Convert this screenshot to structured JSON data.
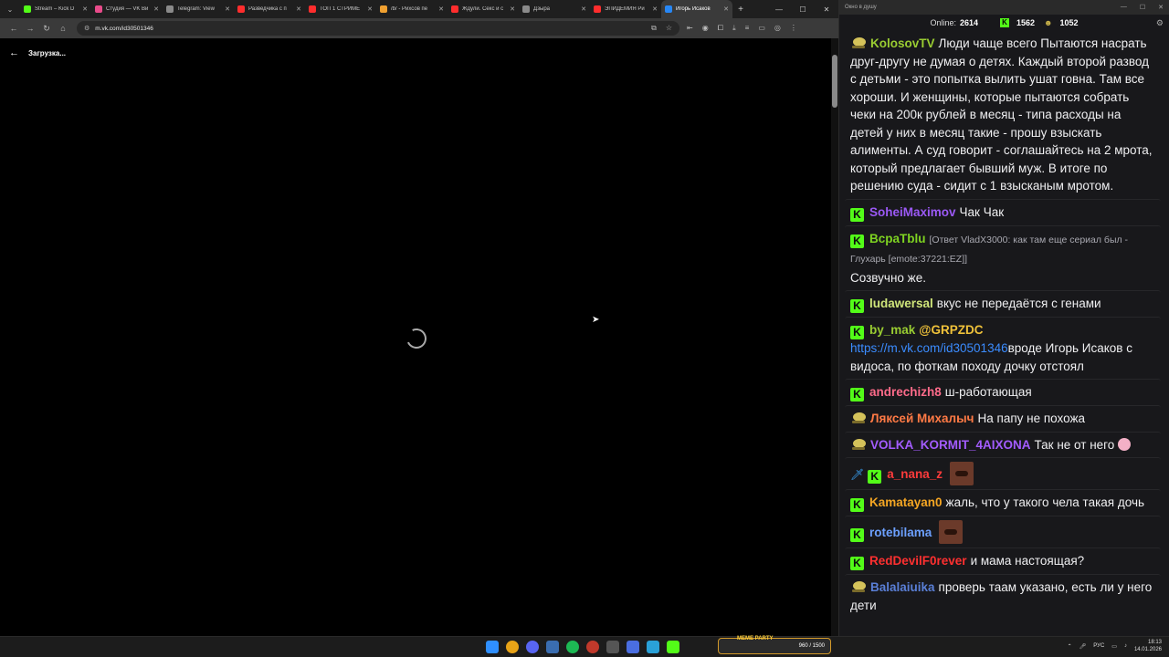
{
  "browser": {
    "tabs": [
      {
        "title": "Stream – Kick D",
        "color": "#53fc18"
      },
      {
        "title": "Студия — VK Ви",
        "color": "#e94b8a"
      },
      {
        "title": "Telegram: View",
        "color": "#8a8a8a"
      },
      {
        "title": "Разведчика с п",
        "color": "#ff2d2d"
      },
      {
        "title": "ТОП 1 СТРИМЕ",
        "color": "#ff2d2d"
      },
      {
        "title": "/b/ - Рихсов пе",
        "color": "#f0a030"
      },
      {
        "title": "Ждули. Секс и с",
        "color": "#ff2d2d"
      },
      {
        "title": "Дзыра",
        "color": "#8a8a8a"
      },
      {
        "title": "ЭПИДЕМИЯ Ри",
        "color": "#ff2d2d"
      },
      {
        "title": "Игорь Исаков",
        "color": "#2787f5",
        "active": true
      }
    ],
    "url": "m.vk.com/id30501346",
    "page_header": "Загрузка..."
  },
  "chat": {
    "window_title": "Окно в душу",
    "online_label": "Online:",
    "online_count": "2614",
    "kick_count": "1562",
    "other_count": "1052",
    "messages": [
      {
        "user": "KolosovTV",
        "color": "#9acd32",
        "badge": "gold",
        "text": "Люди чаще всего Пытаются насрать друг-другу не думая о детях. Каждый второй развод с детьми - это попытка вылить ушат говна. Там все хороши. И женщины, которые пытаются собрать чеки на 200к рублей в месяц - типа расходы на детей у них в месяц такие - прошу взыскать алименты. А суд говорит - соглашайтесь на 2 мрота, который предлагает бывший муж. В итоге по решению суда - сидит с 1 взысканым мротом."
      },
      {
        "user": "SoheiMaximov",
        "color": "#9b59f5",
        "badge": "kick",
        "text": "Чак Чак"
      },
      {
        "user": "ВсраТblu",
        "color": "#7ed321",
        "badge": "kick",
        "reply": "[Ответ VladX3000: как там еще сериал был - Глухарь [emote:37221:EZ]]",
        "text": "Созвучно же."
      },
      {
        "user": "ludawersal",
        "color": "#cfe57a",
        "badge": "kick",
        "text": "вкус не передаётся с генами"
      },
      {
        "user": "by_mak",
        "color": "#9acd32",
        "badge": "kick",
        "mention": "@GRPZDC",
        "link": "https://m.vk.com/id30501346",
        "text": "вроде Игорь Исаков с видоса, по фоткам походу дочку отстоял"
      },
      {
        "user": "andrechizh8",
        "color": "#ff6b8a",
        "badge": "kick",
        "text": "ш-работающая"
      },
      {
        "user": "Ляксей Михалыч",
        "color": "#ff7a45",
        "badge": "gold",
        "text": "На папу не похожа"
      },
      {
        "user": "VOLKA_KORMIT_4AIXONA",
        "color": "#a35cff",
        "badge": "gold",
        "text": "Так не от него",
        "emoji": true
      },
      {
        "user": "a_nana_z",
        "color": "#ff3b3b",
        "badge": "kick",
        "sword": true,
        "emote": true,
        "text": ""
      },
      {
        "user": "Kamatayan0",
        "color": "#f5a623",
        "badge": "kick",
        "text": "жаль, что у такого чела такая дочь"
      },
      {
        "user": "rotebilama",
        "color": "#6ca0ff",
        "badge": "kick",
        "emote": true,
        "text": ""
      },
      {
        "user": "RedDevilF0rever",
        "color": "#ff3030",
        "badge": "kick",
        "text": "и мама настоящая?"
      },
      {
        "user": "Balalaiuika",
        "color": "#5a7fd6",
        "badge": "gold",
        "text": "проверь таам указано, есть ли у него дети"
      }
    ]
  },
  "taskbar": {
    "meme_label": "MEME PARTY",
    "meme_value": "960 / 1500",
    "lang": "РУС",
    "time": "18:13",
    "date": "14.01.2026"
  }
}
